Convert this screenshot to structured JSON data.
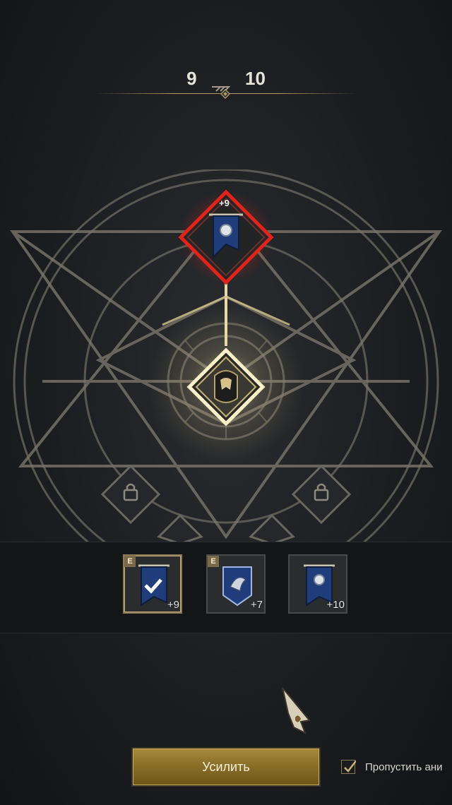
{
  "header": {
    "level_current": "9",
    "level_next": "10"
  },
  "circle": {
    "top_node_plus": "+9",
    "center_node_icon": "helmet-icon",
    "locked_nodes_icon": "lock-icon"
  },
  "tray": {
    "slots": [
      {
        "grade": "E",
        "plus": "+9",
        "icon": "banner-icon",
        "selected": true
      },
      {
        "grade": "E",
        "plus": "+7",
        "icon": "shield-banner-icon",
        "selected": false
      },
      {
        "grade": "",
        "plus": "+10",
        "icon": "banner-icon",
        "selected": false
      }
    ]
  },
  "actions": {
    "enhance_label": "Усилить",
    "skip_label": "Пропустить ани",
    "skip_checked": true
  },
  "colors": {
    "accent_gold": "#b09660",
    "danger_red": "#d0201c",
    "banner_blue": "#1f3d7a"
  }
}
